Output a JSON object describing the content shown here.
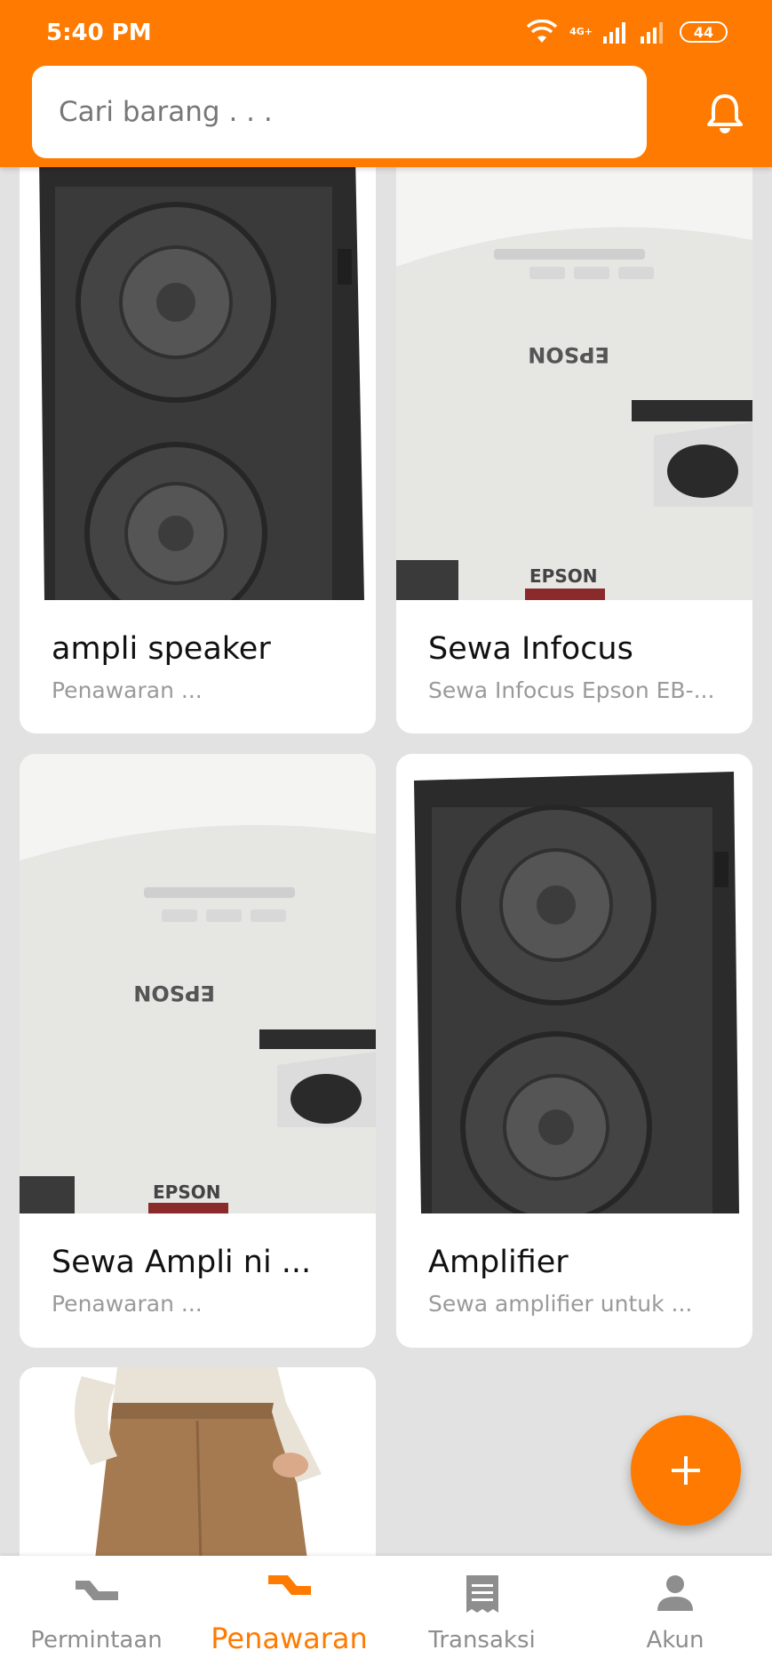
{
  "status_bar": {
    "time": "5:40 PM",
    "network": "4G+",
    "battery": "44"
  },
  "search": {
    "placeholder": "Cari barang . . ."
  },
  "products": [
    {
      "title": "ampli speaker",
      "subtitle": "Penawaran ...",
      "image": "speaker"
    },
    {
      "title": "Sewa Infocus",
      "subtitle": "Sewa Infocus Epson EB-...",
      "image": "projector"
    },
    {
      "title": "Sewa Ampli ni ...",
      "subtitle": "Penawaran ...",
      "image": "projector"
    },
    {
      "title": "Amplifier",
      "subtitle": "Sewa amplifier untuk ...",
      "image": "speaker"
    },
    {
      "title": "",
      "subtitle": "",
      "image": "trousers"
    }
  ],
  "fab": {
    "icon": "plus-icon"
  },
  "bottom_nav": {
    "items": [
      {
        "label": "Permintaan",
        "icon": "request-icon",
        "active": false
      },
      {
        "label": "Penawaran",
        "icon": "offer-icon",
        "active": true
      },
      {
        "label": "Transaksi",
        "icon": "receipt-icon",
        "active": false
      },
      {
        "label": "Akun",
        "icon": "person-icon",
        "active": false
      }
    ]
  },
  "colors": {
    "accent": "#ff7a00",
    "background": "#e2e2e2",
    "inactive": "#8e8e8e"
  }
}
